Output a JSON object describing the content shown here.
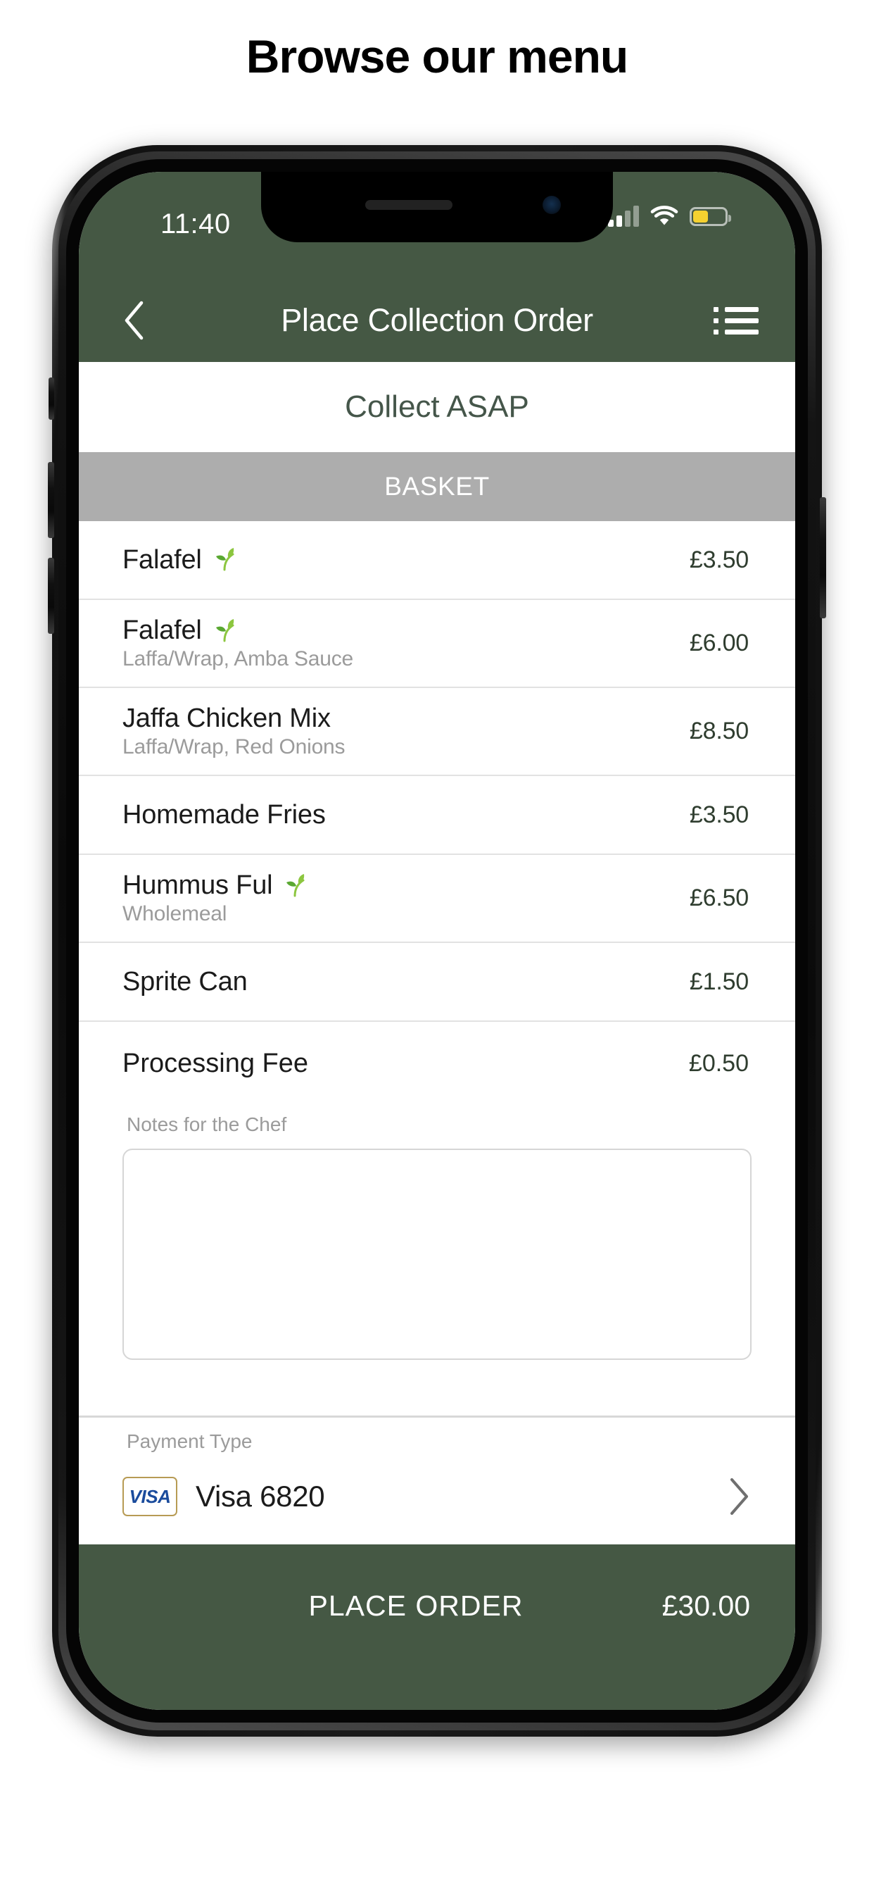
{
  "page": {
    "heading": "Browse our menu"
  },
  "colors": {
    "brand_green": "#455844",
    "basket_header_grey": "#adadad",
    "price_green": "#2f3d2f",
    "battery_yellow": "#f5d130",
    "visa_blue": "#1a4b9c",
    "visa_border_gold": "#b79b54"
  },
  "status_bar": {
    "time": "11:40",
    "signal_icon": "cellular-signal-icon",
    "signal_bars_filled": 2,
    "signal_bars_total": 4,
    "wifi_icon": "wifi-icon",
    "battery_icon": "battery-low-power-icon",
    "battery_percent": 48
  },
  "nav_bar": {
    "back_icon": "chevron-left-icon",
    "title": "Place Collection Order",
    "menu_icon": "list-menu-icon"
  },
  "collect": {
    "label": "Collect ASAP"
  },
  "basket": {
    "header": "BASKET",
    "items": [
      {
        "name": "Falafel",
        "options": "",
        "price": "£3.50",
        "vegan": true
      },
      {
        "name": "Falafel",
        "options": "Laffa/Wrap, Amba Sauce",
        "price": "£6.00",
        "vegan": true
      },
      {
        "name": "Jaffa Chicken Mix",
        "options": "Laffa/Wrap, Red Onions",
        "price": "£8.50",
        "vegan": false
      },
      {
        "name": "Homemade Fries",
        "options": "",
        "price": "£3.50",
        "vegan": false
      },
      {
        "name": "Hummus Ful",
        "options": "Wholemeal",
        "price": "£6.50",
        "vegan": true
      },
      {
        "name": "Sprite Can",
        "options": "",
        "price": "£1.50",
        "vegan": false
      }
    ],
    "fee_label": "Processing Fee",
    "fee_price": "£0.50"
  },
  "notes": {
    "label": "Notes for the Chef",
    "value": "",
    "placeholder": ""
  },
  "payment": {
    "label": "Payment Type",
    "card_brand_icon": "visa-logo-icon",
    "card_brand_text": "VISA",
    "card_name": "Visa 6820",
    "chevron_icon": "chevron-right-icon"
  },
  "place_order": {
    "label": "PLACE ORDER",
    "total": "£30.00"
  },
  "home_indicator": "home-indicator"
}
